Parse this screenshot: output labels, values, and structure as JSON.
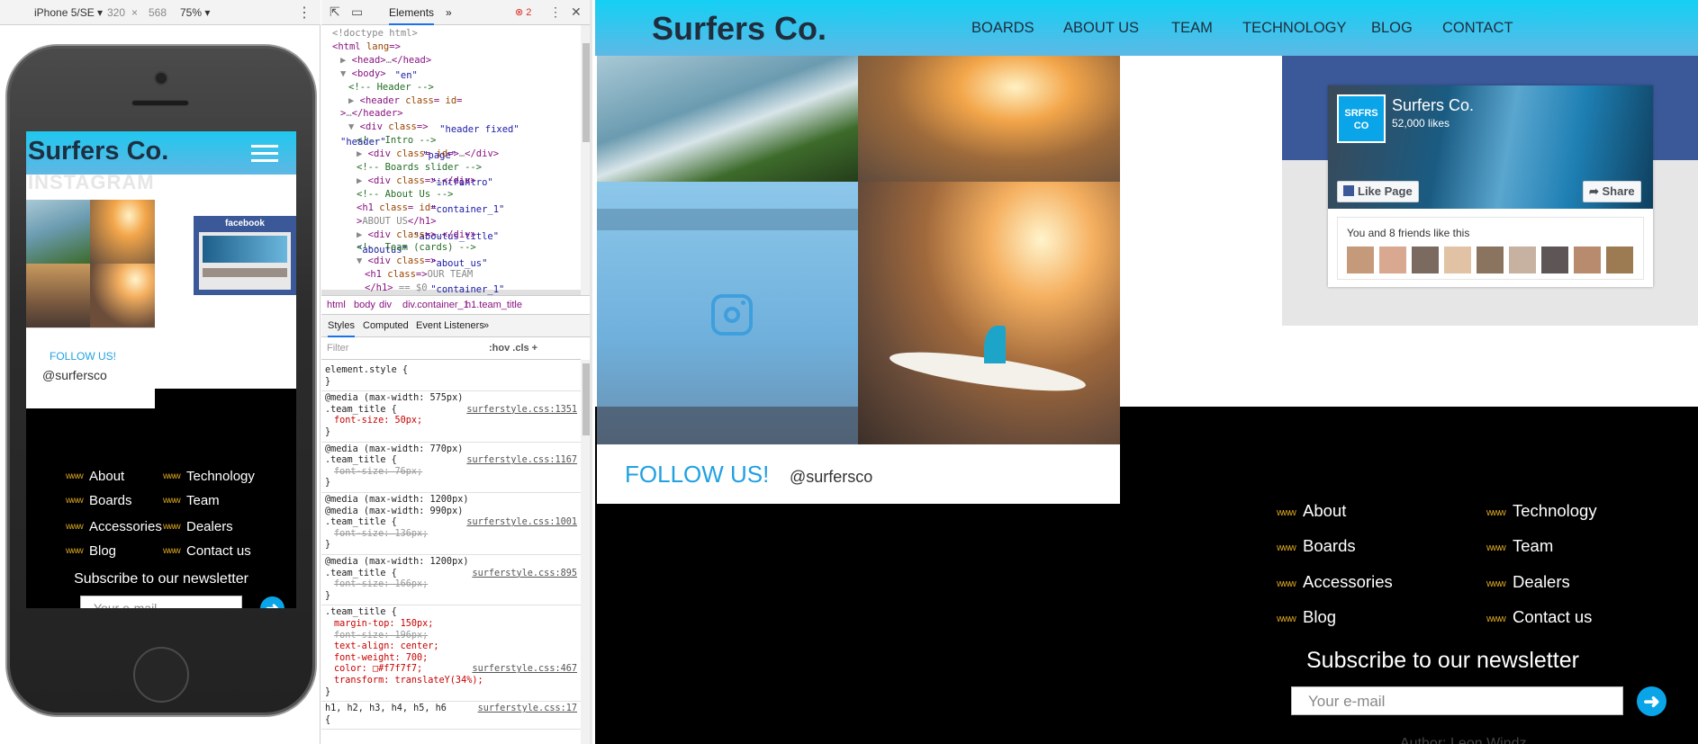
{
  "device_toolbar": {
    "device": "iPhone 5/SE ▾",
    "width": "320",
    "times": "×",
    "height": "568",
    "zoom": "75% ▾",
    "more": "⋮"
  },
  "mobile": {
    "logo": "Surfers Co.",
    "ghost_heading": "INSTAGRAM",
    "fb_title": "facebook",
    "follow": "FOLLOW US!",
    "handle": "@surfersco",
    "links_left": [
      "About",
      "Boards",
      "Accessories",
      "Blog"
    ],
    "links_right": [
      "Technology",
      "Team",
      "Dealers",
      "Contact us"
    ],
    "wave": "www",
    "subscribe": "Subscribe to our newsletter",
    "email_placeholder": "Your e-mail"
  },
  "devtools": {
    "tab_elements": "Elements",
    "tab_more": "»",
    "errors": "⊗ 2",
    "dom_lines": [
      {
        "indent": 0,
        "parts": [
          [
            "gr",
            "<!doctype html>"
          ]
        ]
      },
      {
        "indent": 0,
        "parts": [
          [
            "tg",
            "<html "
          ],
          [
            "at",
            "lang"
          ],
          [
            "tg",
            "="
          ],
          [
            "av",
            "\"en\""
          ],
          [
            "tg",
            ">"
          ]
        ]
      },
      {
        "indent": 1,
        "parts": [
          [
            "gr",
            "▶ "
          ],
          [
            "tg",
            "<head>"
          ],
          [
            "gr",
            "…"
          ],
          [
            "tg",
            "</head>"
          ]
        ]
      },
      {
        "indent": 1,
        "parts": [
          [
            "gr",
            "▼ "
          ],
          [
            "tg",
            "<body>"
          ]
        ]
      },
      {
        "indent": 2,
        "parts": [
          [
            "cm",
            "<!-- Header -->"
          ]
        ]
      },
      {
        "indent": 2,
        "parts": [
          [
            "gr",
            "▶ "
          ],
          [
            "tg",
            "<header "
          ],
          [
            "at",
            "class"
          ],
          [
            "tg",
            "="
          ],
          [
            "av",
            "\"header fixed\""
          ],
          [
            "at",
            " id"
          ],
          [
            "tg",
            "="
          ]
        ]
      },
      {
        "indent": 1,
        "parts": [
          [
            "av",
            "\"header\""
          ],
          [
            "tg",
            ">"
          ],
          [
            "gr",
            "…"
          ],
          [
            "tg",
            "</header>"
          ]
        ]
      },
      {
        "indent": 2,
        "parts": [
          [
            "gr",
            "▼ "
          ],
          [
            "tg",
            "<div "
          ],
          [
            "at",
            "class"
          ],
          [
            "tg",
            "="
          ],
          [
            "av",
            "\"page\""
          ],
          [
            "tg",
            ">"
          ]
        ]
      },
      {
        "indent": 3,
        "parts": [
          [
            "cm",
            "<!-- Intro -->"
          ]
        ]
      },
      {
        "indent": 3,
        "parts": [
          [
            "gr",
            "▶ "
          ],
          [
            "tg",
            "<div "
          ],
          [
            "at",
            "class"
          ],
          [
            "tg",
            "="
          ],
          [
            "av",
            "\"intro\""
          ],
          [
            "at",
            " id"
          ],
          [
            "tg",
            "="
          ],
          [
            "av",
            "\"intro\""
          ],
          [
            "tg",
            ">"
          ],
          [
            "gr",
            "…"
          ],
          [
            "tg",
            "</div>"
          ]
        ]
      },
      {
        "indent": 3,
        "parts": [
          [
            "cm",
            "<!-- Boards slider -->"
          ]
        ]
      },
      {
        "indent": 3,
        "parts": [
          [
            "gr",
            "▶ "
          ],
          [
            "tg",
            "<div "
          ],
          [
            "at",
            "class"
          ],
          [
            "tg",
            "="
          ],
          [
            "av",
            "\"container_1\""
          ],
          [
            "tg",
            ">"
          ],
          [
            "gr",
            "…"
          ],
          [
            "tg",
            "</div>"
          ]
        ]
      },
      {
        "indent": 3,
        "parts": [
          [
            "cm",
            "<!-- About Us -->"
          ]
        ]
      },
      {
        "indent": 3,
        "parts": [
          [
            "tg",
            "<h1 "
          ],
          [
            "at",
            "class"
          ],
          [
            "tg",
            "="
          ],
          [
            "av",
            "\"aboutus_title\""
          ],
          [
            "at",
            " id"
          ],
          [
            "tg",
            "="
          ]
        ]
      },
      {
        "indent": 3,
        "parts": [
          [
            "av",
            "\"aboutus\""
          ],
          [
            "tg",
            ">"
          ],
          [
            "gr",
            "ABOUT US"
          ],
          [
            "tg",
            "</h1>"
          ]
        ]
      },
      {
        "indent": 3,
        "parts": [
          [
            "gr",
            "▶ "
          ],
          [
            "tg",
            "<div "
          ],
          [
            "at",
            "class"
          ],
          [
            "tg",
            "="
          ],
          [
            "av",
            "\"about_us\""
          ],
          [
            "tg",
            ">"
          ],
          [
            "gr",
            "…"
          ],
          [
            "tg",
            "</div>"
          ]
        ]
      },
      {
        "indent": 3,
        "parts": [
          [
            "cm",
            "<!-- Team (cards) -->"
          ]
        ]
      },
      {
        "indent": 3,
        "parts": [
          [
            "gr",
            "▼ "
          ],
          [
            "tg",
            "<div "
          ],
          [
            "at",
            "class"
          ],
          [
            "tg",
            "="
          ],
          [
            "av",
            "\"container_1\""
          ],
          [
            "tg",
            ">"
          ]
        ]
      },
      {
        "indent": 4,
        "parts": [
          [
            "tg",
            "<h1 "
          ],
          [
            "at",
            "class"
          ],
          [
            "tg",
            "="
          ],
          [
            "av",
            "\"team_title\""
          ],
          [
            "tg",
            ">"
          ],
          [
            "gr",
            "OUR TEAM"
          ]
        ]
      },
      {
        "indent": 4,
        "parts": [
          [
            "tg",
            "</h1>"
          ],
          [
            "gr",
            " == $0"
          ]
        ]
      }
    ],
    "breadcrumbs": [
      "html",
      "body",
      "div",
      "div.container_1",
      "h1.team_title"
    ],
    "style_tabs": [
      "Styles",
      "Computed",
      "Event Listeners",
      "»"
    ],
    "filter_placeholder": "Filter",
    "filter_tools": ":hov  .cls  +",
    "rules": [
      {
        "lines": [
          [
            "sel",
            "element.style {"
          ],
          [
            "sel",
            "}"
          ]
        ],
        "src": ""
      },
      {
        "lines": [
          [
            "sel",
            "@media (max-width: 575px)"
          ],
          [
            "sel",
            ".team_title {"
          ],
          [
            "prop",
            "font-size: 50px;"
          ],
          [
            "sel",
            "}"
          ]
        ],
        "src": "surferstyle.css:1351"
      },
      {
        "lines": [
          [
            "sel",
            "@media (max-width: 770px)"
          ],
          [
            "sel",
            ".team_title {"
          ],
          [
            "strike",
            "font-size: 76px;"
          ],
          [
            "sel",
            "}"
          ]
        ],
        "src": "surferstyle.css:1167"
      },
      {
        "lines": [
          [
            "sel",
            "@media (max-width: 1200px)"
          ],
          [
            "sel",
            "@media (max-width: 990px)"
          ],
          [
            "sel",
            ".team_title {"
          ],
          [
            "strike",
            "font-size: 136px;"
          ],
          [
            "sel",
            "}"
          ]
        ],
        "src": "surferstyle.css:1001"
      },
      {
        "lines": [
          [
            "sel",
            "@media (max-width: 1200px)"
          ],
          [
            "sel",
            ".team_title {"
          ],
          [
            "strike",
            "font-size: 166px;"
          ],
          [
            "sel",
            "}"
          ]
        ],
        "src": "surferstyle.css:895"
      },
      {
        "lines": [
          [
            "sel",
            ".team_title {"
          ],
          [
            "prop",
            "margin-top: 150px;"
          ],
          [
            "strike",
            "font-size: 196px;"
          ],
          [
            "prop",
            "text-align: center;"
          ],
          [
            "prop",
            "font-weight: 700;"
          ],
          [
            "prop",
            "color: □#f7f7f7;"
          ],
          [
            "prop",
            "transform: translateY(34%);"
          ],
          [
            "sel",
            "}"
          ]
        ],
        "src": "surferstyle.css:467"
      },
      {
        "lines": [
          [
            "sel",
            "h1, h2, h3, h4, h5, h6"
          ],
          [
            "sel",
            "{"
          ]
        ],
        "src": "surferstyle.css:17"
      }
    ]
  },
  "desktop": {
    "logo": "Surfers Co.",
    "nav": [
      "BOARDS",
      "ABOUT US",
      "TEAM",
      "TECHNOLOGY",
      "BLOG",
      "CONTACT"
    ],
    "follow": "FOLLOW US!",
    "handle": "@surfersco",
    "facebook": {
      "logo_line1": "SRFRS",
      "logo_line2": "CO",
      "name": "Surfers Co.",
      "likes": "52,000 likes",
      "like_button": "Like Page",
      "share_button": "➦ Share",
      "friends_text": "You and 8 friends like this"
    },
    "links_left": [
      "About",
      "Boards",
      "Accessories",
      "Blog"
    ],
    "links_right": [
      "Technology",
      "Team",
      "Dealers",
      "Contact us"
    ],
    "wave": "www",
    "subscribe": "Subscribe to our newsletter",
    "email_placeholder": "Your e-mail",
    "cut_text": "Author: Leon Windz"
  },
  "colors": {
    "header_cyan": "#14d0f4",
    "link_blue": "#21a1e1",
    "wave_gold": "#d9a521",
    "facebook_blue": "#3b5998",
    "button_blue": "#0aa5e8"
  }
}
